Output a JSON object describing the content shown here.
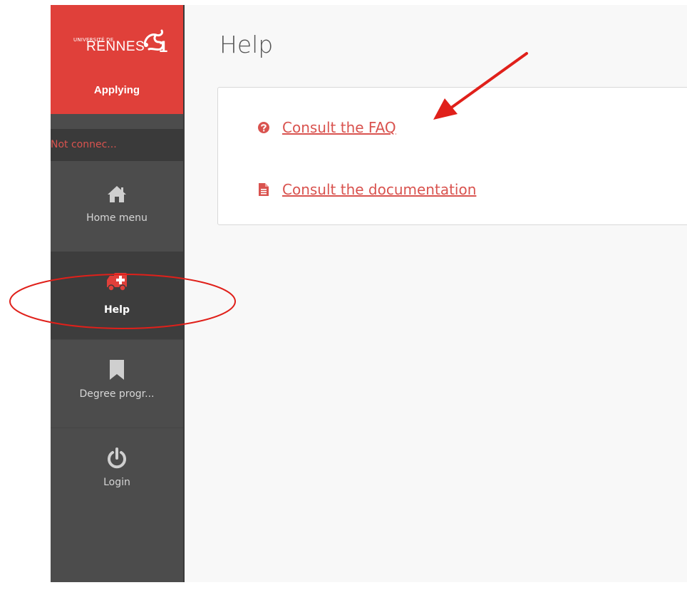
{
  "sidebar": {
    "logo": {
      "small_text": "UNIVERSITÉ DE",
      "big_text": "RENNES",
      "numeral": "1"
    },
    "app_name": "Applying",
    "status": "Not connec...",
    "items": [
      {
        "label": "Home menu",
        "icon": "home-icon"
      },
      {
        "label": "Help",
        "icon": "ambulance-icon",
        "active": true
      },
      {
        "label": "Degree progr...",
        "icon": "bookmark-icon"
      },
      {
        "label": "Login",
        "icon": "power-icon"
      }
    ]
  },
  "main": {
    "title": "Help",
    "links": [
      {
        "label": "Consult the FAQ",
        "icon": "question-circle-icon"
      },
      {
        "label": "Consult the documentation",
        "icon": "document-icon"
      }
    ]
  },
  "colors": {
    "brand": "#e0403a",
    "sidebar": "#4c4c4c",
    "sidebar_dark": "#3a3a3a",
    "link": "#d9534f",
    "annotation": "#e0201a"
  }
}
